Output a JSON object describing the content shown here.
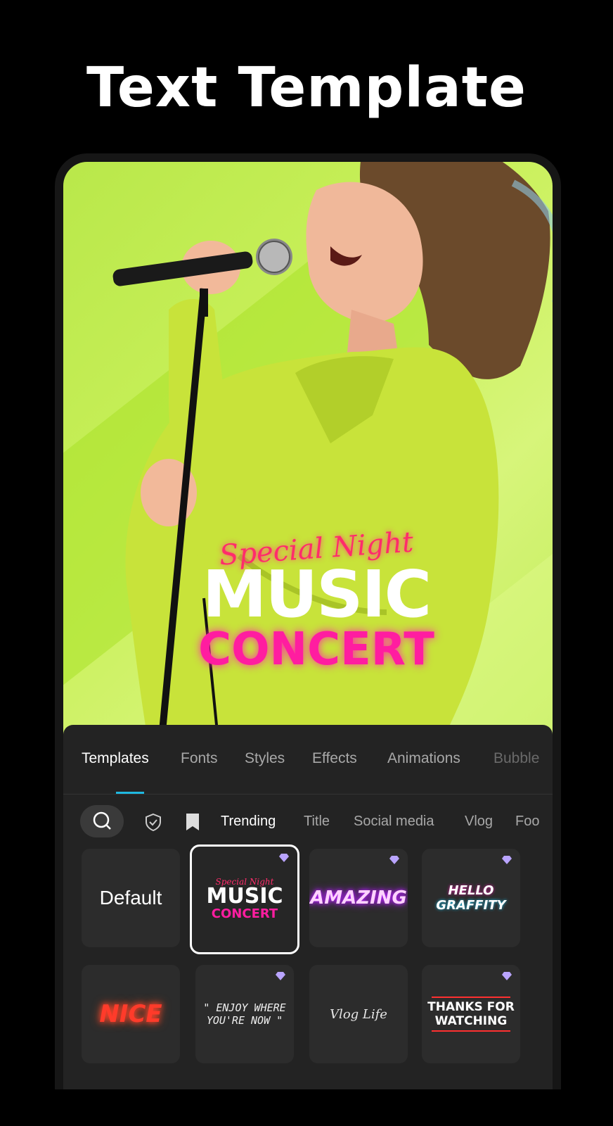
{
  "headline": "Text Template",
  "preview": {
    "overlay": {
      "special": "Special Night",
      "music": "MUSIC",
      "concert": "CONCERT"
    }
  },
  "tabs": [
    "Templates",
    "Fonts",
    "Styles",
    "Effects",
    "Animations",
    "Bubble"
  ],
  "active_tab": "Templates",
  "filters": {
    "search_icon": "search-icon",
    "shield_icon": "shield-check-icon",
    "bookmark_icon": "bookmark-icon",
    "chips": [
      "Trending",
      "Title",
      "Social media",
      "Vlog",
      "Foo"
    ],
    "active": "Trending"
  },
  "templates": {
    "default": "Default",
    "music_concert": {
      "line1": "Special Night",
      "line2": "MUSIC",
      "line3": "CONCERT"
    },
    "amazing": "AMAZING",
    "hello_graffity": {
      "line1": "HELLO",
      "line2": "GRAFFITY"
    },
    "nice": "NICE",
    "enjoy": {
      "line1": "\" ENJOY WHERE",
      "line2": "YOU'RE NOW \""
    },
    "vlog_life": "Vlog Life",
    "thanks": {
      "line1": "THANKS FOR",
      "line2": "WATCHING"
    }
  },
  "colors": {
    "accent": "#1fb8e0",
    "premium_gem": "#b9a4ff",
    "neon_pink": "#ff1da0",
    "lime": "#c6ee5a"
  }
}
